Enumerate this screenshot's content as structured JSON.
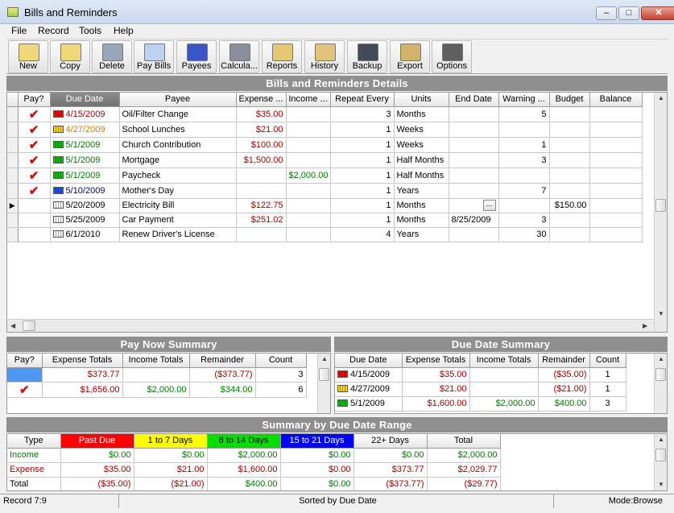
{
  "window": {
    "title": "Bills and Reminders"
  },
  "menu": [
    "File",
    "Record",
    "Tools",
    "Help"
  ],
  "toolbar": [
    {
      "label": "New",
      "icon": "new-document-icon"
    },
    {
      "label": "Copy",
      "icon": "copy-icon"
    },
    {
      "label": "Delete",
      "icon": "delete-icon"
    },
    {
      "label": "Pay Bills",
      "icon": "pay-bills-icon"
    },
    {
      "label": "Payees",
      "icon": "payees-icon"
    },
    {
      "label": "Calcula...",
      "icon": "calculator-icon"
    },
    {
      "label": "Reports",
      "icon": "reports-icon"
    },
    {
      "label": "History",
      "icon": "history-icon"
    },
    {
      "label": "Backup",
      "icon": "backup-disk-icon"
    },
    {
      "label": "Export",
      "icon": "export-icon"
    },
    {
      "label": "Options",
      "icon": "options-icon"
    }
  ],
  "details": {
    "title": "Bills and Reminders Details",
    "columns": [
      "Pay?",
      "Due Date",
      "Payee",
      "Expense ...",
      "Income ...",
      "Repeat Every",
      "Units",
      "End Date",
      "Warning ...",
      "Budget",
      "Balance"
    ],
    "rows": [
      {
        "pay": "✔",
        "due": "4/15/2009",
        "cal": "red",
        "due_color": "red",
        "payee": "Oil/Filter Change",
        "expense": "$35.00",
        "income": "",
        "repeat": "3",
        "units": "Months",
        "end": "",
        "warning": "5",
        "budget": "",
        "balance": ""
      },
      {
        "pay": "✔",
        "due": "4/27/2009",
        "cal": "yellow",
        "due_color": "orange",
        "payee": "School Lunches",
        "expense": "$21.00",
        "income": "",
        "repeat": "1",
        "units": "Weeks",
        "end": "",
        "warning": "",
        "budget": "",
        "balance": ""
      },
      {
        "pay": "✔",
        "due": "5/1/2009",
        "cal": "green",
        "due_color": "green",
        "payee": "Church Contribution",
        "expense": "$100.00",
        "income": "",
        "repeat": "1",
        "units": "Weeks",
        "end": "",
        "warning": "1",
        "budget": "",
        "balance": ""
      },
      {
        "pay": "✔",
        "due": "5/1/2009",
        "cal": "green",
        "due_color": "green",
        "payee": "Mortgage",
        "expense": "$1,500.00",
        "income": "",
        "repeat": "1",
        "units": "Half Months",
        "end": "",
        "warning": "3",
        "budget": "",
        "balance": ""
      },
      {
        "pay": "✔",
        "due": "5/1/2009",
        "cal": "green",
        "due_color": "green",
        "payee": "Paycheck",
        "expense": "",
        "income": "$2,000.00",
        "repeat": "1",
        "units": "Half Months",
        "end": "",
        "warning": "",
        "budget": "",
        "balance": ""
      },
      {
        "pay": "✔",
        "due": "5/10/2009",
        "cal": "blue",
        "due_color": "blue",
        "payee": "Mother's Day",
        "expense": "",
        "income": "",
        "repeat": "1",
        "units": "Years",
        "end": "",
        "warning": "7",
        "budget": "",
        "balance": ""
      },
      {
        "pay": "",
        "due": "5/20/2009",
        "cal": "white",
        "due_color": "black",
        "payee": "Electricity Bill",
        "expense": "$122.75",
        "income": "",
        "repeat": "1",
        "units": "Months",
        "end": "...",
        "warning": "",
        "budget": "$150.00",
        "balance": "",
        "current": true
      },
      {
        "pay": "",
        "due": "5/25/2009",
        "cal": "white",
        "due_color": "black",
        "payee": "Car Payment",
        "expense": "$251.02",
        "income": "",
        "repeat": "1",
        "units": "Months",
        "end": "8/25/2009",
        "warning": "3",
        "budget": "",
        "balance": ""
      },
      {
        "pay": "",
        "due": "6/1/2010",
        "cal": "white",
        "due_color": "black",
        "payee": "Renew Driver's License",
        "expense": "",
        "income": "",
        "repeat": "4",
        "units": "Years",
        "end": "",
        "warning": "30",
        "budget": "",
        "balance": ""
      }
    ]
  },
  "pay_now": {
    "title": "Pay Now Summary",
    "columns": [
      "Pay?",
      "Expense Totals",
      "Income Totals",
      "Remainder",
      "Count"
    ],
    "rows": [
      {
        "pay": "",
        "expense": "$373.77",
        "income": "",
        "remainder": "($373.77)",
        "count": "3"
      },
      {
        "pay": "✔",
        "expense": "$1,656.00",
        "income": "$2,000.00",
        "remainder": "$344.00",
        "count": "6"
      }
    ]
  },
  "due_summary": {
    "title": "Due Date Summary",
    "columns": [
      "Due Date",
      "Expense Totals",
      "Income Totals",
      "Remainder",
      "Count"
    ],
    "rows": [
      {
        "cal": "red",
        "due": "4/15/2009",
        "expense": "$35.00",
        "income": "",
        "remainder": "($35.00)",
        "count": "1"
      },
      {
        "cal": "yellow",
        "due": "4/27/2009",
        "expense": "$21.00",
        "income": "",
        "remainder": "($21.00)",
        "count": "1"
      },
      {
        "cal": "green",
        "due": "5/1/2009",
        "expense": "$1,600.00",
        "income": "$2,000.00",
        "remainder": "$400.00",
        "count": "3"
      }
    ]
  },
  "range_summary": {
    "title": "Summary by Due Date Range",
    "columns": [
      "Type",
      "Past Due",
      "1 to 7 Days",
      "8 to 14 Days",
      "15 to 21 Days",
      "22+ Days",
      "Total"
    ],
    "column_colors": [
      "",
      "#ff0000",
      "#ffff00",
      "#00dd00",
      "#0000ff",
      "",
      ""
    ],
    "column_text_colors": [
      "#000",
      "#ffffff",
      "#000000",
      "#000000",
      "#ffffff",
      "#000",
      "#000"
    ],
    "rows": [
      {
        "type": "Income",
        "type_color": "green",
        "values": [
          "$0.00",
          "$0.00",
          "$2,000.00",
          "$0.00",
          "$0.00",
          "$2,000.00"
        ],
        "colors": [
          "green",
          "green",
          "green",
          "green",
          "green",
          "green"
        ]
      },
      {
        "type": "Expense",
        "type_color": "red",
        "values": [
          "$35.00",
          "$21.00",
          "$1,600.00",
          "$0.00",
          "$373.77",
          "$2,029.77"
        ],
        "colors": [
          "red",
          "red",
          "red",
          "red",
          "red",
          "red"
        ]
      },
      {
        "type": "Total",
        "type_color": "black",
        "values": [
          "($35.00)",
          "($21.00)",
          "$400.00",
          "$0.00",
          "($373.77)",
          "($29.77)"
        ],
        "colors": [
          "red",
          "red",
          "green",
          "green",
          "red",
          "red"
        ]
      }
    ]
  },
  "status": {
    "record": "Record  7:9",
    "sort": "Sorted by Due Date",
    "mode": "Mode:Browse"
  },
  "colors": {
    "red": "#ff0000",
    "yellow": "#ffd700",
    "green": "#00c000",
    "blue": "#2050ff",
    "white": "#ffffff"
  }
}
